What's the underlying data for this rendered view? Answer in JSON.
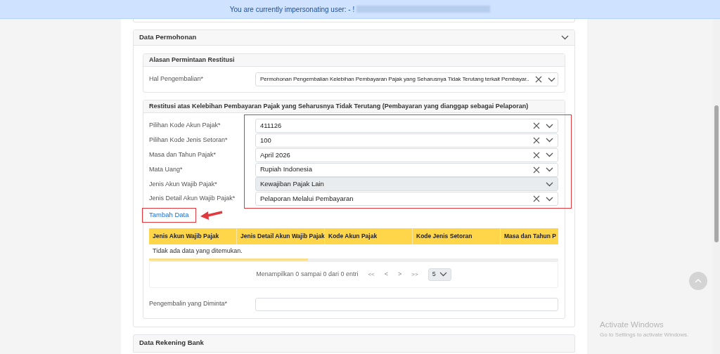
{
  "banner": {
    "text": "You are currently impersonating user: - !"
  },
  "permohonan": {
    "title": "Data Permohonan",
    "alasan": {
      "title": "Alasan Permintaan Restitusi",
      "label": "Hal Pengembalian*",
      "value": "Permohonan Pengembalian Kelebihan Pembayaran Pajak yang Seharusnya Tidak Terutang terkait Pembayar.."
    },
    "restitusi": {
      "title": "Restitusi atas Kelebihan Pembayaran Pajak yang Seharusnya Tidak Terutang (Pembayaran yang dianggap sebagai Pelaporan)",
      "fields": [
        {
          "label": "Pilihan Kode Akun Pajak*",
          "value": "411126",
          "disabled": false
        },
        {
          "label": "Pilihan Kode Jenis Setoran*",
          "value": "100",
          "disabled": false
        },
        {
          "label": "Masa dan Tahun Pajak*",
          "value": "April 2026",
          "disabled": false
        },
        {
          "label": "Mata Uang*",
          "value": "Rupiah Indonesia",
          "disabled": false
        },
        {
          "label": "Jenis Akun Wajib Pajak*",
          "value": "Kewajiban Pajak Lain",
          "disabled": true
        },
        {
          "label": "Jenis Detail Akun Wajib Pajak*",
          "value": "Pelaporan Melalui Pembayaran",
          "disabled": false
        }
      ],
      "add_link": "Tambah Data",
      "table": {
        "columns": [
          "Jenis Akun Wajib Pajak",
          "Jenis Detail Akun Wajib Pajak",
          "Kode Akun Pajak",
          "Kode Jenis Setoran",
          "Masa dan Tahun P"
        ],
        "empty": "Tidak ada data yang ditemukan.",
        "pagination": {
          "info": "Menampilkan 0 sampai 0 dari 0 entri",
          "first": "<<",
          "prev": "<",
          "next": ">",
          "last": ">>",
          "page_size": "5"
        }
      },
      "requested": {
        "label": "Pengembalin yang Diminta*"
      }
    }
  },
  "rekening": {
    "title": "Data Rekening Bank"
  },
  "activation": {
    "title": "Activate Windows",
    "subtitle": "Go to Settings to activate Windows."
  }
}
